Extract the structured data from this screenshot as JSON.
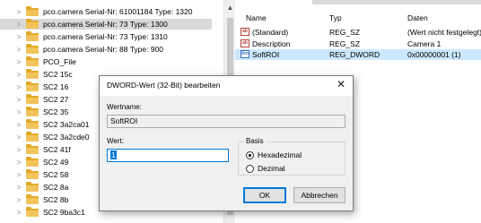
{
  "tree": {
    "items": [
      {
        "label": "pco.camera Serial-Nr: 61001184 Type: 1320",
        "selected": false
      },
      {
        "label": "pco.camera Serial-Nr: 73 Type: 1300",
        "selected": true
      },
      {
        "label": "pco.camera Serial-Nr: 73 Type: 1310",
        "selected": false
      },
      {
        "label": "pco.camera Serial-Nr: 88 Type: 900",
        "selected": false
      },
      {
        "label": "PCO_File",
        "selected": false
      },
      {
        "label": "SC2 15c",
        "selected": false
      },
      {
        "label": "SC2 16",
        "selected": false
      },
      {
        "label": "SC2 27",
        "selected": false
      },
      {
        "label": "SC2 35",
        "selected": false
      },
      {
        "label": "SC2 3a2ca01",
        "selected": false
      },
      {
        "label": "SC2 3a2cde0",
        "selected": false
      },
      {
        "label": "SC2 41f",
        "selected": false
      },
      {
        "label": "SC2 49",
        "selected": false
      },
      {
        "label": "SC2 58",
        "selected": false
      },
      {
        "label": "SC2 8a",
        "selected": false
      },
      {
        "label": "SC2 8b",
        "selected": false
      },
      {
        "label": "SC2 9ba3c1",
        "selected": false
      }
    ]
  },
  "list": {
    "columns": {
      "name": "Name",
      "type": "Typ",
      "data": "Daten"
    },
    "rows": [
      {
        "icon": "ab",
        "name": "(Standard)",
        "type": "REG_SZ",
        "data": "(Wert nicht festgelegt)",
        "selected": false
      },
      {
        "icon": "ab",
        "name": "Description",
        "type": "REG_SZ",
        "data": "Camera 1",
        "selected": false
      },
      {
        "icon": "bin",
        "name": "SoftROI",
        "type": "REG_DWORD",
        "data": "0x00000001 (1)",
        "selected": true
      }
    ]
  },
  "dialog": {
    "title": "DWORD-Wert (32-Bit) bearbeiten",
    "close_glyph": "✕",
    "name_label": "Wertname:",
    "name_value": "SoftROI",
    "value_label": "Wert:",
    "value_value": "1",
    "base_label": "Basis",
    "radio_hex": "Hexadezimal",
    "radio_dec": "Dezimal",
    "selected_base": "hex",
    "ok_label": "OK",
    "cancel_label": "Abbrechen"
  },
  "colors": {
    "tree_selected": "#d9d9d9",
    "list_selected": "#cce8ff",
    "accent": "#0078d7",
    "folder": "#f1c45b"
  }
}
